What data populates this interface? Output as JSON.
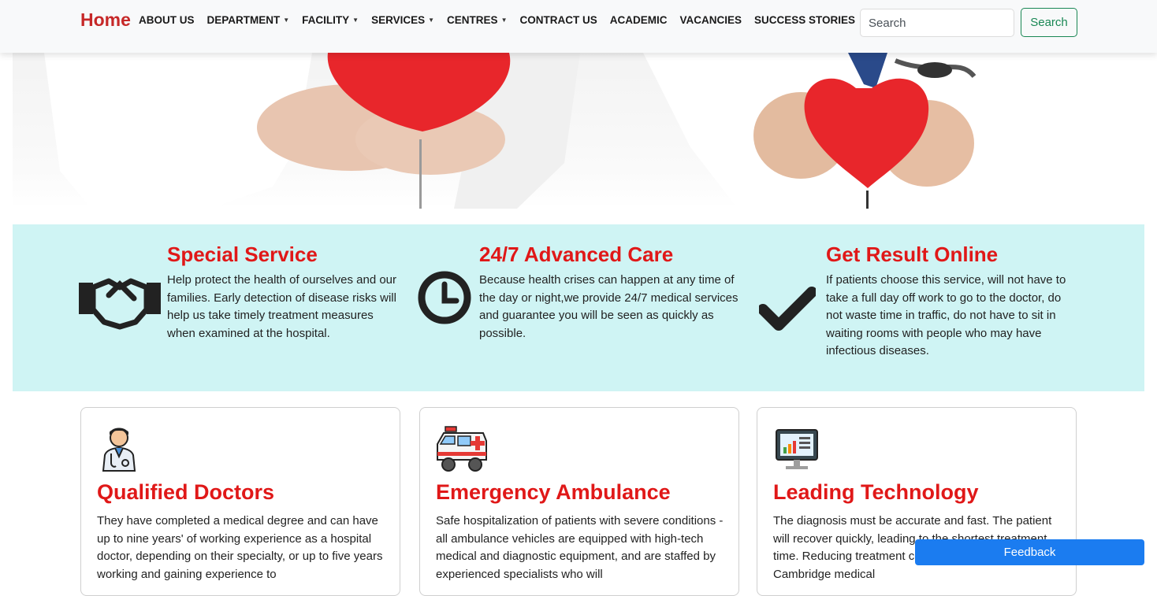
{
  "navbar": {
    "brand": "Home",
    "items": [
      {
        "label": "ABOUT US",
        "dropdown": false
      },
      {
        "label": "DEPARTMENT",
        "dropdown": true
      },
      {
        "label": "FACILITY",
        "dropdown": true
      },
      {
        "label": "SERVICES",
        "dropdown": true
      },
      {
        "label": "CENTRES",
        "dropdown": true
      },
      {
        "label": "CONTRACT US",
        "dropdown": false
      },
      {
        "label": "ACADEMIC",
        "dropdown": false
      },
      {
        "label": "VACANCIES",
        "dropdown": false
      },
      {
        "label": "SUCCESS STORIES",
        "dropdown": false
      }
    ],
    "search_placeholder": "Search",
    "search_button": "Search"
  },
  "features": [
    {
      "title": "Special Service",
      "icon": "handshake-icon",
      "text": "Help protect the health of ourselves and our families. Early detection of disease risks will help us take timely treatment measures when examined at the hospital."
    },
    {
      "title": "24/7 Advanced Care",
      "icon": "clock-icon",
      "text": "Because health crises can happen at any time of the day or night,we provide 24/7 medical services and guarantee you will be seen as quickly as possible."
    },
    {
      "title": "Get Result Online",
      "icon": "checkmark-icon",
      "text": "If patients choose this service, will not have to take a full day off work to go to the doctor, do not waste time in traffic, do not have to sit in waiting rooms with people who may have infectious diseases."
    }
  ],
  "cards": [
    {
      "title": "Qualified Doctors",
      "icon": "doctor-icon",
      "text": "They have completed a medical degree and can have up to nine years' of working experience as a hospital doctor, depending on their specialty, or up to five years working and gaining experience to"
    },
    {
      "title": "Emergency Ambulance",
      "icon": "ambulance-icon",
      "text": "Safe hospitalization of patients with severe conditions - all ambulance vehicles are equipped with high-tech medical and diagnostic equipment, and are staffed by experienced specialists who will"
    },
    {
      "title": "Leading Technology",
      "icon": "monitor-chart-icon",
      "text": "The diagnosis must be accurate and fast. The patient will recover quickly, leading to the shortest treatment time. Reducing treatment costs. Therefore, CHA Cambridge medical"
    }
  ],
  "feedback_label": "Feedback",
  "colors": {
    "brand": "#c62828",
    "heading_red": "#e01818",
    "features_bg": "#cff4f4",
    "search_green": "#198754",
    "feedback_blue": "#1b7cf0"
  }
}
